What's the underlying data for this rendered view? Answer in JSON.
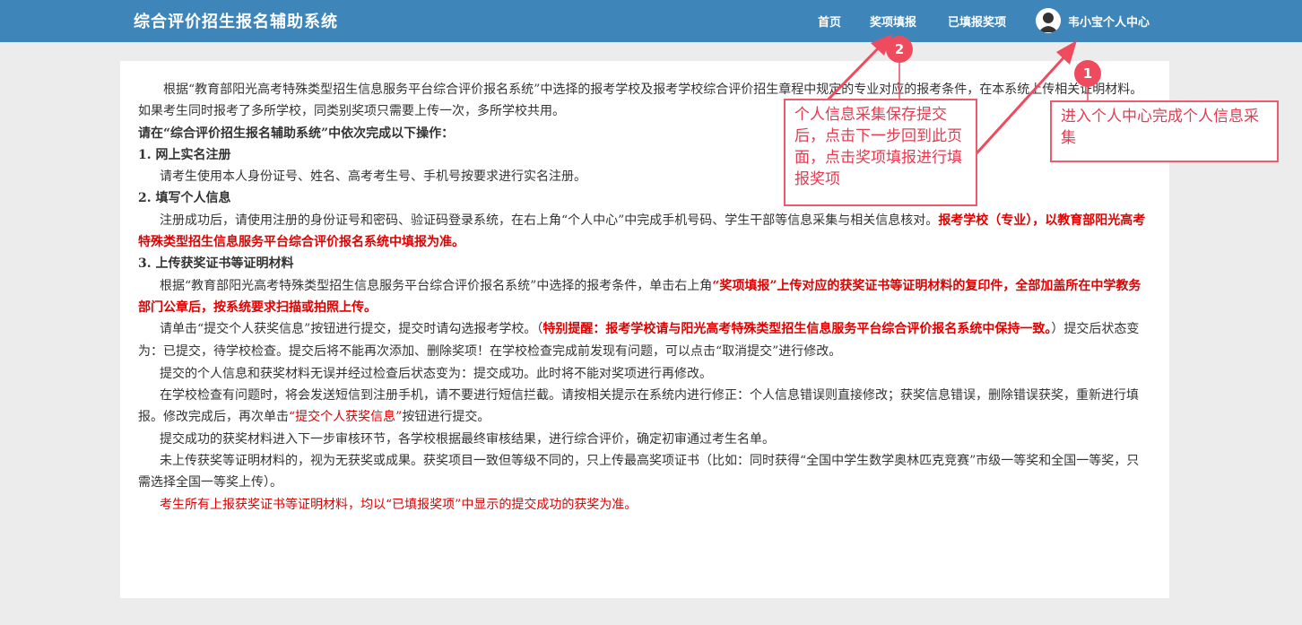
{
  "header": {
    "title": "综合评价招生报名辅助系统",
    "nav": [
      "首页",
      "奖项填报",
      "已填报奖项"
    ],
    "user_label": "韦小宝个人中心"
  },
  "content": {
    "intro": "根据“教育部阳光高考特殊类型招生信息服务平台综合评价报名系统”中选择的报考学校及报考学校综合评价招生章程中规定的专业对应的报考条件，在本系统上传相关证明材料。如果考生同时报考了多所学校，同类别奖项只需要上传一次，多所学校共用。",
    "instruction_heading": "请在“综合评价招生报名辅助系统”中依次完成以下操作：",
    "step1_title": "1. 网上实名注册",
    "step1_text": "请考生使用本人身份证号、姓名、高考考生号、手机号按要求进行实名注册。",
    "step2_title": "2. 填写个人信息",
    "step2_text": "注册成功后，请使用注册的身份证号和密码、验证码登录系统，在右上角“个人中心”中完成手机号码、学生干部等信息采集与相关信息核对。",
    "step2_red": "报考学校（专业），以教育部阳光高考特殊类型招生信息服务平台综合评价报名系统中填报为准。",
    "step3_title": "3. 上传获奖证书等证明材料",
    "step3_text": "根据“教育部阳光高考特殊类型招生信息服务平台综合评价报名系统”中选择的报考条件，单击右上角",
    "step3_red": "“奖项填报”上传对应的获奖证书等证明材料的复印件，全部加盖所在中学教务部门公章后，按系统要求扫描或拍照上传。",
    "para4_a": "请单击“提交个人获奖信息”按钮进行提交，提交时请勾选报考学校。（",
    "para4_red": "特别提醒：报考学校请与阳光高考特殊类型招生信息服务平台综合评价报名系统中保持一致。",
    "para4_b": "）提交后状态变为：已提交，待学校检查。提交后将不能再次添加、删除奖项！在学校检查完成前发现有问题，可以点击“取消提交”进行修改。",
    "para5": "提交的个人信息和获奖材料无误并经过检查后状态变为：提交成功。此时将不能对奖项进行再修改。",
    "para6_a": "在学校检查有问题时，将会发送短信到注册手机，请不要进行短信拦截。请按相关提示在系统内进行修正：个人信息错误则直接修改；获奖信息错误，删除错误获奖，重新进行填报。修改完成后，再次单击",
    "para6_red": "“提交个人获奖信息”",
    "para6_b": "按钮进行提交。",
    "para7": "提交成功的获奖材料进入下一步审核环节，各学校根据最终审核结果，进行综合评价，确定初审通过考生名单。",
    "para8": "未上传获奖等证明材料的，视为无获奖或成果。获奖项目一致但等级不同的，只上传最高奖项证书（比如：同时获得“全国中学生数学奥林匹克竞赛”市级一等奖和全国一等奖，只需选择全国一等奖上传）。",
    "para9_red": "考生所有上报获奖证书等证明材料，均以“已填报奖项”中显示的提交成功的获奖为准。"
  },
  "callouts": {
    "badge1": "1",
    "badge2": "2",
    "callout1": "进入个人中心完成个人信息采集",
    "callout2": "个人信息采集保存提交后，点击下一步回到此页面，点击奖项填报进行填报奖项"
  },
  "colors": {
    "header_bg": "#3e86b9",
    "accent_red": "#e00000",
    "callout_red": "#ef4b5f"
  }
}
